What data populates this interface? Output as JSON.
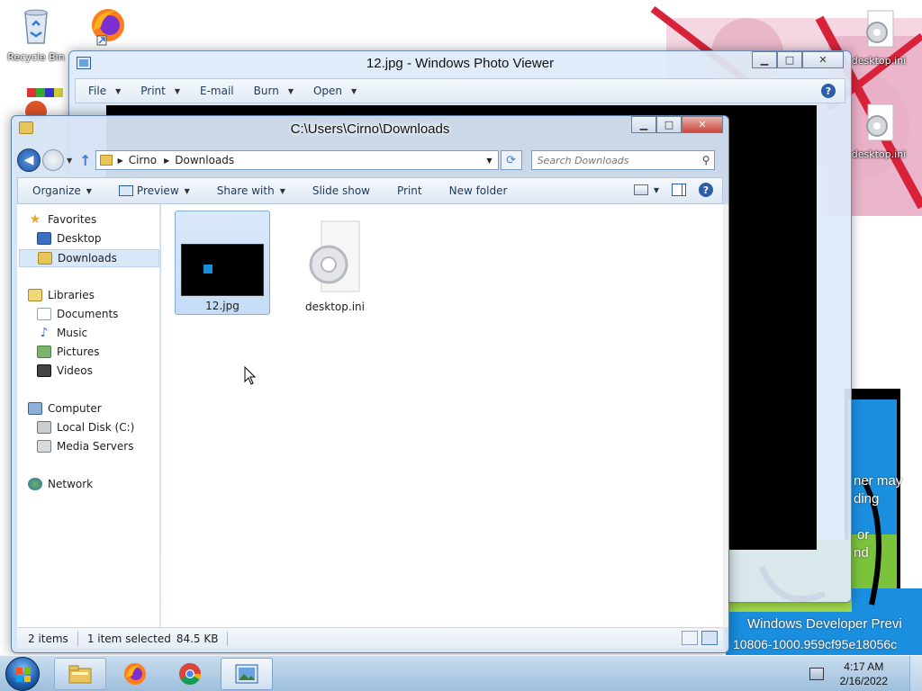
{
  "desktop": {
    "icons": [
      {
        "label": "Recycle Bin",
        "icon": "recycle-bin-icon"
      },
      {
        "label": "",
        "icon": "firefox-icon"
      },
      {
        "label": "desktop.ini",
        "icon": "settings-file-icon"
      },
      {
        "label": "desktop.ini",
        "icon": "settings-file-icon"
      }
    ],
    "overlay_texts": [
      "ner may",
      "ding",
      "or",
      "nd",
      "Windows Developer Previ",
      "10806-1000.959cf95e18056c"
    ]
  },
  "photo_viewer": {
    "title": "12.jpg - Windows Photo Viewer",
    "menus": [
      {
        "label": "File",
        "has_arrow": true
      },
      {
        "label": "Print",
        "has_arrow": true
      },
      {
        "label": "E-mail",
        "has_arrow": false
      },
      {
        "label": "Burn",
        "has_arrow": true
      },
      {
        "label": "Open",
        "has_arrow": true
      }
    ],
    "help": "?"
  },
  "explorer": {
    "title": "C:\\Users\\Cirno\\Downloads",
    "breadcrumb": [
      "Cirno",
      "Downloads"
    ],
    "search_placeholder": "Search Downloads",
    "toolbar": [
      {
        "label": "Organize",
        "has_arrow": true
      },
      {
        "label": "Preview",
        "has_arrow": true
      },
      {
        "label": "Share with",
        "has_arrow": true
      },
      {
        "label": "Slide show",
        "has_arrow": false
      },
      {
        "label": "Print",
        "has_arrow": false
      },
      {
        "label": "New folder",
        "has_arrow": false
      }
    ],
    "nav": {
      "favorites": {
        "label": "Favorites",
        "items": [
          "Desktop",
          "Downloads"
        ]
      },
      "libraries": {
        "label": "Libraries",
        "items": [
          "Documents",
          "Music",
          "Pictures",
          "Videos"
        ]
      },
      "computer": {
        "label": "Computer",
        "items": [
          "Local Disk (C:)",
          "Media Servers"
        ]
      },
      "network": {
        "label": "Network"
      }
    },
    "selected_nav": "Downloads",
    "files": [
      {
        "name": "12.jpg",
        "selected": true
      },
      {
        "name": "desktop.ini",
        "selected": false
      }
    ],
    "status": {
      "count": "2 items",
      "selection": "1 item selected",
      "size": "84.5 KB"
    }
  },
  "taskbar": {
    "apps": [
      "windows-explorer-icon",
      "firefox-icon",
      "chrome-icon",
      "photo-viewer-icon"
    ],
    "time": "4:17 AM",
    "date": "2/16/2022"
  },
  "colors": {
    "accent": "#2d5fa8",
    "selection": "#c5dcf6"
  }
}
